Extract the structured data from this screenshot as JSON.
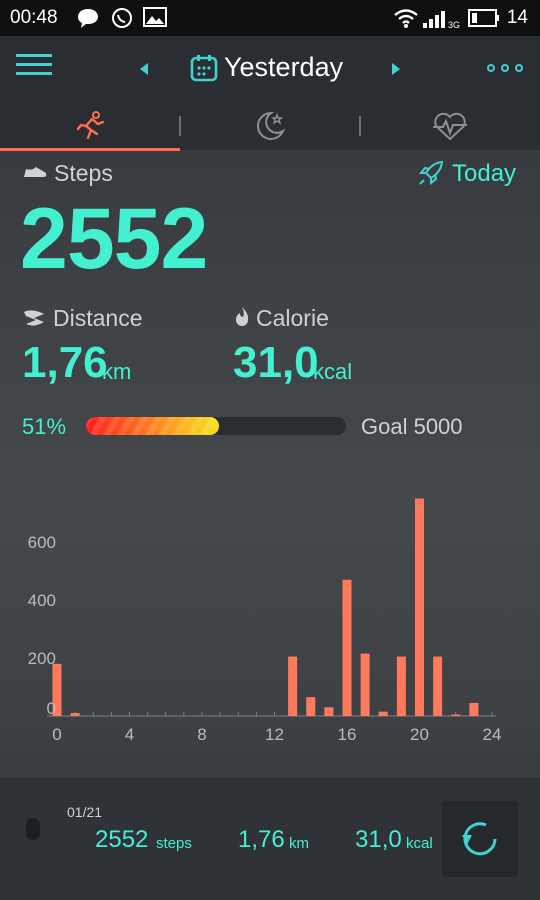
{
  "status_bar": {
    "time": "00:48",
    "battery": "14"
  },
  "header": {
    "title": "Yesterday"
  },
  "steps": {
    "label": "Steps",
    "value": "2552",
    "today_link": "Today"
  },
  "distance": {
    "label": "Distance",
    "value": "1,76",
    "unit": "km"
  },
  "calorie": {
    "label": "Calorie",
    "value": "31,0",
    "unit": "kcal"
  },
  "goal": {
    "percent_label": "51%",
    "progress": 0.51,
    "goal_label": "Goal 5000"
  },
  "chart_data": {
    "type": "bar",
    "x": [
      0,
      1,
      2,
      3,
      4,
      5,
      6,
      7,
      8,
      9,
      10,
      11,
      12,
      13,
      14,
      15,
      16,
      17,
      18,
      19,
      20,
      21,
      22,
      23,
      24
    ],
    "values": [
      180,
      10,
      0,
      0,
      0,
      0,
      0,
      0,
      0,
      0,
      0,
      0,
      0,
      205,
      65,
      30,
      470,
      215,
      15,
      205,
      750,
      205,
      5,
      45,
      0
    ],
    "xticks": [
      "0",
      "4",
      "8",
      "12",
      "16",
      "20",
      "24"
    ],
    "yticks": [
      "0",
      "200",
      "400",
      "600"
    ],
    "ylim": [
      0,
      800
    ],
    "color": "#ff7a5c"
  },
  "footer": {
    "date": "01/21",
    "steps_value": "2552",
    "steps_unit": "steps",
    "distance_value": "1,76",
    "distance_unit": "km",
    "calorie_value": "31,0",
    "calorie_unit": "kcal"
  }
}
